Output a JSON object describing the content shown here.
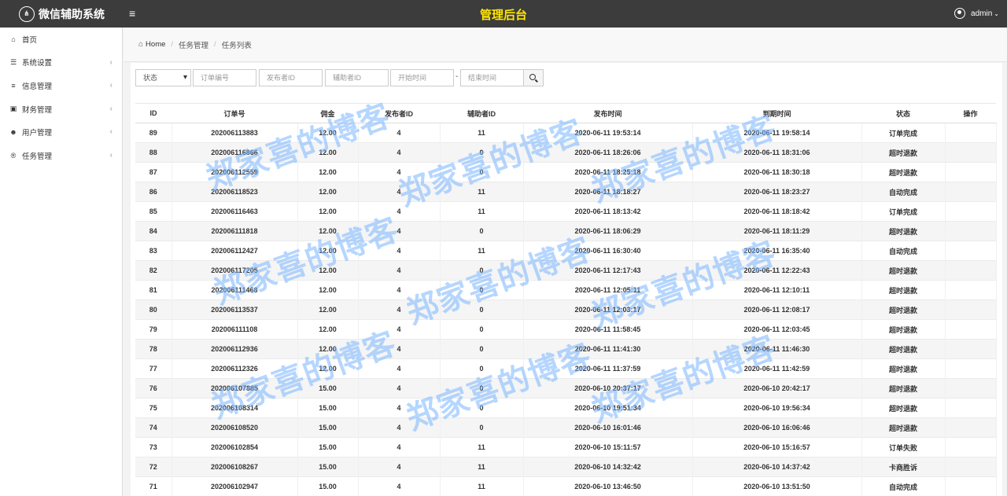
{
  "app": {
    "name": "微信辅助系统",
    "logo": "⋔",
    "page_title": "管理后台",
    "user": "admin"
  },
  "sidebar": {
    "items": [
      {
        "label": "首页",
        "icon": "home-icon",
        "glyph": "⌂",
        "arrow": ""
      },
      {
        "label": "系统设置",
        "icon": "settings-icon",
        "glyph": "☰",
        "arrow": "‹"
      },
      {
        "label": "信息管理",
        "icon": "list-icon",
        "glyph": "≡",
        "arrow": "‹"
      },
      {
        "label": "财务管理",
        "icon": "money-icon",
        "glyph": "▣",
        "arrow": "‹"
      },
      {
        "label": "用户管理",
        "icon": "users-icon",
        "glyph": "☻",
        "arrow": "‹"
      },
      {
        "label": "任务管理",
        "icon": "task-icon",
        "glyph": "®",
        "arrow": "‹"
      }
    ]
  },
  "breadcrumb": {
    "home": "Home",
    "level1": "任务管理",
    "level2": "任务列表"
  },
  "filters": {
    "status": "状态",
    "order_no": "订单编号",
    "publisher_id": "发布者ID",
    "helper_id": "辅助者ID",
    "start_time": "开始时间",
    "separator": "-",
    "end_time": "结束时间"
  },
  "table": {
    "headers": [
      "ID",
      "订单号",
      "佣金",
      "发布者ID",
      "辅助者ID",
      "发布时间",
      "到期时间",
      "状态",
      "操作"
    ],
    "rows": [
      [
        "89",
        "202006113883",
        "12.00",
        "4",
        "11",
        "2020-06-11 19:53:14",
        "2020-06-11 19:58:14",
        "订单完成",
        ""
      ],
      [
        "88",
        "202006116866",
        "12.00",
        "4",
        "0",
        "2020-06-11 18:26:06",
        "2020-06-11 18:31:06",
        "超时退款",
        ""
      ],
      [
        "87",
        "202006112559",
        "12.00",
        "4",
        "0",
        "2020-06-11 18:25:18",
        "2020-06-11 18:30:18",
        "超时退款",
        ""
      ],
      [
        "86",
        "202006118523",
        "12.00",
        "4",
        "11",
        "2020-06-11 18:18:27",
        "2020-06-11 18:23:27",
        "自动完成",
        ""
      ],
      [
        "85",
        "202006116463",
        "12.00",
        "4",
        "11",
        "2020-06-11 18:13:42",
        "2020-06-11 18:18:42",
        "订单完成",
        ""
      ],
      [
        "84",
        "202006111818",
        "12.00",
        "4",
        "0",
        "2020-06-11 18:06:29",
        "2020-06-11 18:11:29",
        "超时退款",
        ""
      ],
      [
        "83",
        "202006112427",
        "12.00",
        "4",
        "11",
        "2020-06-11 16:30:40",
        "2020-06-11 16:35:40",
        "自动完成",
        ""
      ],
      [
        "82",
        "202006117205",
        "12.00",
        "4",
        "0",
        "2020-06-11 12:17:43",
        "2020-06-11 12:22:43",
        "超时退款",
        ""
      ],
      [
        "81",
        "202006111468",
        "12.00",
        "4",
        "0",
        "2020-06-11 12:05:11",
        "2020-06-11 12:10:11",
        "超时退款",
        ""
      ],
      [
        "80",
        "202006113537",
        "12.00",
        "4",
        "0",
        "2020-06-11 12:03:17",
        "2020-06-11 12:08:17",
        "超时退款",
        ""
      ],
      [
        "79",
        "202006111108",
        "12.00",
        "4",
        "0",
        "2020-06-11 11:58:45",
        "2020-06-11 12:03:45",
        "超时退款",
        ""
      ],
      [
        "78",
        "202006112936",
        "12.00",
        "4",
        "0",
        "2020-06-11 11:41:30",
        "2020-06-11 11:46:30",
        "超时退款",
        ""
      ],
      [
        "77",
        "202006112326",
        "12.00",
        "4",
        "0",
        "2020-06-11 11:37:59",
        "2020-06-11 11:42:59",
        "超时退款",
        ""
      ],
      [
        "76",
        "202006107885",
        "15.00",
        "4",
        "0",
        "2020-06-10 20:37:17",
        "2020-06-10 20:42:17",
        "超时退款",
        ""
      ],
      [
        "75",
        "202006108314",
        "15.00",
        "4",
        "0",
        "2020-06-10 19:51:34",
        "2020-06-10 19:56:34",
        "超时退款",
        ""
      ],
      [
        "74",
        "202006108520",
        "15.00",
        "4",
        "0",
        "2020-06-10 16:01:46",
        "2020-06-10 16:06:46",
        "超时退款",
        ""
      ],
      [
        "73",
        "202006102854",
        "15.00",
        "4",
        "11",
        "2020-06-10 15:11:57",
        "2020-06-10 15:16:57",
        "订单失败",
        ""
      ],
      [
        "72",
        "202006108267",
        "15.00",
        "4",
        "11",
        "2020-06-10 14:32:42",
        "2020-06-10 14:37:42",
        "卡商胜诉",
        ""
      ],
      [
        "71",
        "202006102947",
        "15.00",
        "4",
        "11",
        "2020-06-10 13:46:50",
        "2020-06-10 13:51:50",
        "自动完成",
        ""
      ]
    ]
  },
  "watermark": {
    "text": "郑家喜的博客"
  }
}
